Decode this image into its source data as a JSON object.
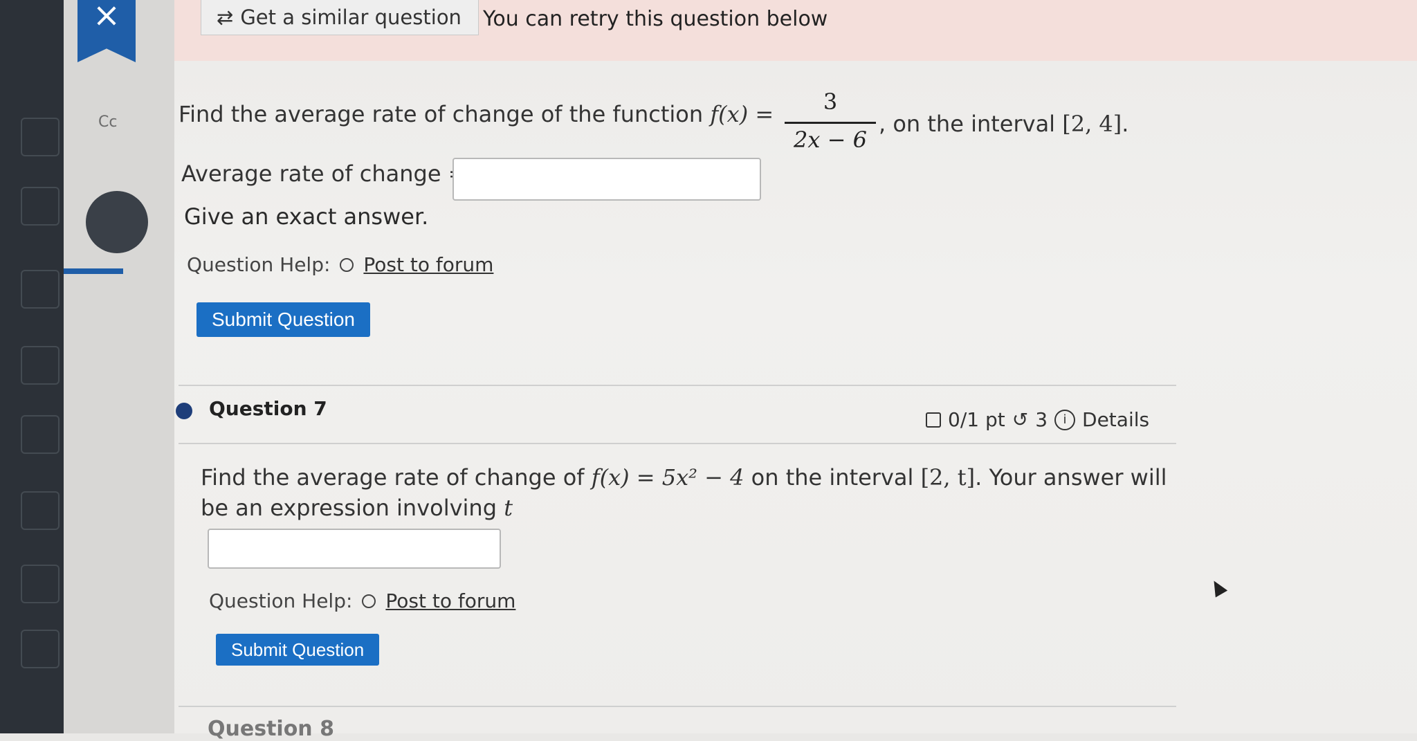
{
  "banner": {
    "close_glyph": "×",
    "similar_label": "Get a similar question",
    "retry_text": "You can retry this question below"
  },
  "sidebar": {
    "cut_label": "Cc"
  },
  "question6": {
    "prompt_start": "Find the average rate of change of the function ",
    "function_lhs": "f(x) =",
    "fraction_numerator": "3",
    "fraction_denominator": "2x − 6",
    "prompt_end": ", on the interval ",
    "interval": "[2, 4]",
    "period": ".",
    "answer_label": "Average rate of change =",
    "answer_value": "",
    "instruction": "Give an exact answer.",
    "help_label": "Question Help:",
    "forum_link": "Post to forum",
    "submit_label": "Submit Question"
  },
  "question7": {
    "title": "Question 7",
    "points": "0/1 pt",
    "retries": "3",
    "details_label": "Details",
    "prompt_a": "Find the average rate of change of ",
    "function": "f(x) = 5x² − 4",
    "prompt_b": " on the interval ",
    "interval": "[2, t]",
    "prompt_c": ". Your answer will be an expression involving ",
    "variable": "t",
    "answer_value": "",
    "help_label": "Question Help:",
    "forum_link": "Post to forum",
    "submit_label": "Submit Question"
  },
  "question8": {
    "title_peek": "Question 8"
  },
  "colors": {
    "accent": "#1b6fc4",
    "banner": "#f4dfdb",
    "sidebar": "#2c3138",
    "dot": "#1e3e7a"
  }
}
